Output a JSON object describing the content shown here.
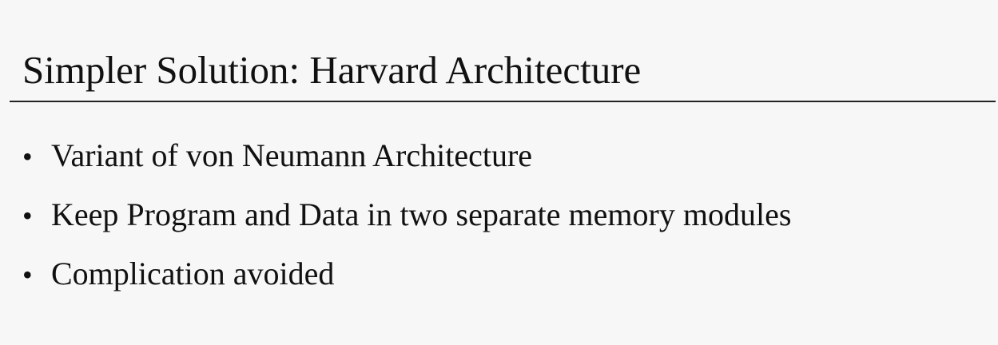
{
  "slide": {
    "title": "Simpler Solution: Harvard Architecture",
    "bullet_glyph": "•",
    "bullets": [
      "Variant of von Neumann Architecture",
      "Keep Program and Data in two separate memory modules",
      "Complication avoided"
    ]
  }
}
